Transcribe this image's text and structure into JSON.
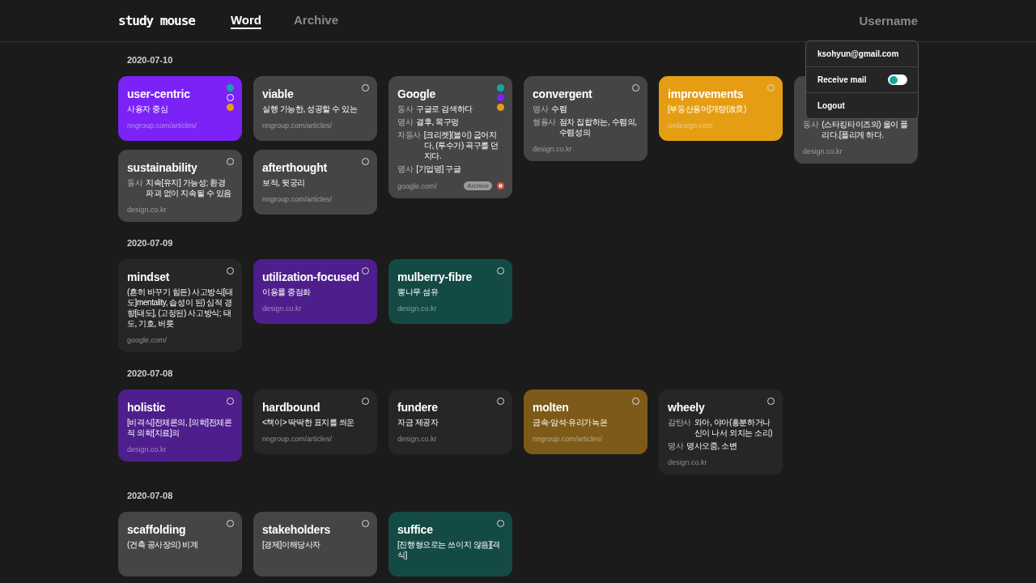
{
  "header": {
    "logo": "study mouse",
    "nav": [
      {
        "label": "Word",
        "selected": true
      },
      {
        "label": "Archive",
        "selected": false
      }
    ],
    "user": "Username"
  },
  "user_menu": {
    "email": "ksohyun@gmail.com",
    "receive_mail": {
      "label": "Receive mail",
      "on": false
    },
    "logout": "Logout"
  },
  "sections": [
    {
      "date": "2020-07-10",
      "cards": [
        {
          "title": "user-centric",
          "color": "#7b22f7",
          "definitions": [
            {
              "text": "사용자 중심"
            }
          ],
          "source": "nngroup.com/articles/",
          "swatches": [
            {
              "color": "#12a99a",
              "selected": false
            },
            {
              "color": "#7b22f7",
              "selected": true
            },
            {
              "color": "#e59e14",
              "selected": false
            }
          ]
        },
        {
          "title": "viable",
          "color": "#454545",
          "definitions": [
            {
              "text": "실행 가능한, 성공할 수 있는"
            }
          ],
          "source": "nngroup.com/articles/"
        },
        {
          "title": "Google",
          "color": "#454545",
          "definitions": [
            {
              "pos": "동사",
              "text": "구글로 검색하다"
            },
            {
              "pos": "명사",
              "text": "결후, 목구멍"
            },
            {
              "pos": "자동사",
              "text": "[크리켓](볼이) 굽어지다, (투수가) 곡구를 던지다."
            },
            {
              "pos": "명사",
              "text": "[기업명] 구글"
            }
          ],
          "source": "google.com/",
          "tag": "Archive",
          "deletable": true,
          "swatches": [
            {
              "color": "#12a99a",
              "selected": false
            },
            {
              "color": "#7b22f7",
              "selected": false
            },
            {
              "color": "#e59e14",
              "selected": false
            }
          ]
        },
        {
          "title": "convergent",
          "color": "#454545",
          "definitions": [
            {
              "pos": "명사",
              "text": "수렴"
            },
            {
              "pos": "형용사",
              "text": "점차 집합하는, 수렴의, 수렴성의"
            }
          ],
          "source": "design.co.kr"
        },
        {
          "title": "improvements",
          "color": "#e59e14",
          "definitions": [
            {
              "text": "[부동산용어]개량(改良)"
            }
          ],
          "source": "uxdesign.com"
        },
        {
          "color": "#454545",
          "definitions": [
            {
              "pos": "동사",
              "text": "(스타킹타이즈의) 올이 풀리다.[풀리게 하다."
            }
          ],
          "source": "design.co.kr"
        },
        {
          "title": "sustainability",
          "color": "#454545",
          "definitions": [
            {
              "pos": "동사",
              "text": "지속[유지] 가능성; 환경 파괴 없이 지속될 수 있음"
            }
          ],
          "source": "design.co.kr"
        },
        {
          "title": "afterthought",
          "color": "#454545",
          "definitions": [
            {
              "text": "보적, 뒷궁리"
            }
          ],
          "source": "nngroup.com/articles/"
        }
      ]
    },
    {
      "date": "2020-07-09",
      "cards": [
        {
          "title": "mindset",
          "color": "#262626",
          "definitions": [
            {
              "text": "(흔히 바꾸기 힘든) 사고방식[태도]mentality, 습성이 된) 심적 경향[태도], (고정된) 사고방식; 태도, 기호, 버릇"
            }
          ],
          "source": "google.com/"
        },
        {
          "title": "utilization-focused",
          "color": "#4e1e8c",
          "definitions": [
            {
              "text": "이용률 중점화"
            }
          ],
          "source": "design.co.kr"
        },
        {
          "title": "mulberry-fibre",
          "color": "#144a45",
          "definitions": [
            {
              "text": "뽕나무 섬유"
            }
          ],
          "source": "design.co.kr"
        }
      ]
    },
    {
      "date": "2020-07-08",
      "cards": [
        {
          "title": "holistic",
          "color": "#4e1e8c",
          "definitions": [
            {
              "text": "[비격식]전체론의, [의학]전체론적 의학[치료]의"
            }
          ],
          "source": "design.co.kr"
        },
        {
          "title": "hardbound",
          "color": "#262626",
          "definitions": [
            {
              "text": "<책이> 딱딱한 표지를 씌운"
            }
          ],
          "source": "nngroup.com/articles/"
        },
        {
          "title": "fundere",
          "color": "#262626",
          "definitions": [
            {
              "text": "자금 제공자"
            }
          ],
          "source": "design.co.kr"
        },
        {
          "title": "molten",
          "color": "#7d5a18",
          "definitions": [
            {
              "text": "금속·암석·유리가녹은"
            }
          ],
          "source": "nngroup.com/articles/"
        },
        {
          "title": "wheely",
          "color": "#262626",
          "definitions": [
            {
              "pos": "감탄사",
              "text": "와아, 야아(흥분하거나 신이 나서 외치는 소리)"
            },
            {
              "pos": "명사",
              "text": "명사오줌, 소변"
            }
          ],
          "source": "design.co.kr"
        }
      ]
    },
    {
      "date": "2020-07-08",
      "cards": [
        {
          "title": "scaffolding",
          "color": "#454545",
          "definitions": [
            {
              "text": "(건축 공사장의) 비계"
            }
          ]
        },
        {
          "title": "stakeholders",
          "color": "#454545",
          "definitions": [
            {
              "text": "[경제]이해당사자"
            }
          ]
        },
        {
          "title": "suffice",
          "color": "#144a45",
          "definitions": [
            {
              "text": "[진행형으로는 쓰이지 않음][격식]"
            }
          ]
        }
      ]
    }
  ]
}
